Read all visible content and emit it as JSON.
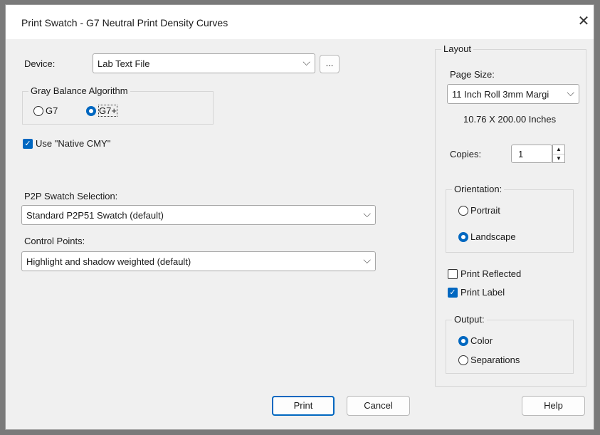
{
  "dialog": {
    "title": "Print Swatch - G7 Neutral Print Density Curves",
    "close_icon": "close-icon"
  },
  "device": {
    "label": "Device:",
    "value": "Lab Text File",
    "more_label": "..."
  },
  "gray_balance": {
    "legend": "Gray Balance Algorithm",
    "options": [
      "G7",
      "G7+"
    ],
    "selected": "G7+"
  },
  "native_cmy": {
    "label": "Use \"Native CMY\"",
    "checked": true
  },
  "swatch": {
    "label": "P2P Swatch Selection:",
    "value": "Standard P2P51 Swatch (default)"
  },
  "control_points": {
    "label": "Control Points:",
    "value": "Highlight and shadow weighted (default)"
  },
  "layout": {
    "legend": "Layout",
    "page_size_label": "Page Size:",
    "page_size_value": "11 Inch Roll 3mm Margi",
    "dimensions": "10.76 X 200.00 Inches",
    "copies_label": "Copies:",
    "copies_value": "1",
    "orientation": {
      "legend": "Orientation:",
      "options": [
        "Portrait",
        "Landscape"
      ],
      "selected": "Landscape"
    },
    "print_reflected": {
      "label": "Print Reflected",
      "checked": false
    },
    "print_label": {
      "label": "Print Label",
      "checked": true
    },
    "output": {
      "legend": "Output:",
      "options": [
        "Color",
        "Separations"
      ],
      "selected": "Color"
    }
  },
  "buttons": {
    "print": "Print",
    "cancel": "Cancel",
    "help": "Help"
  },
  "colors": {
    "accent": "#0067c0"
  }
}
